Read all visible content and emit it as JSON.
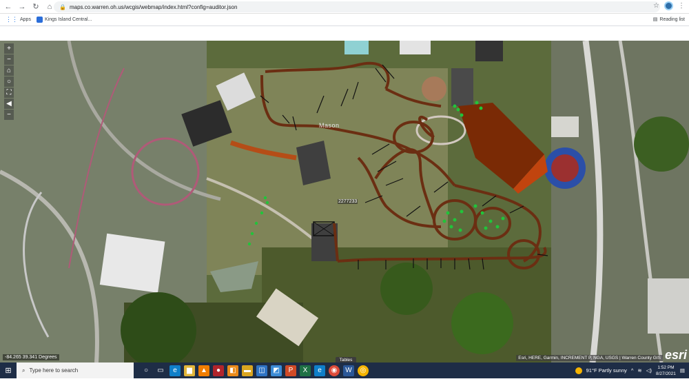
{
  "browser": {
    "url": "maps.co.warren.oh.us/wcgis/webmap/index.html?config=auditor.json",
    "bookmarks": [
      {
        "label": "Apps"
      },
      {
        "label": "Kings Island Central..."
      }
    ],
    "reading_list": "Reading list"
  },
  "map": {
    "place_label": "Mason",
    "parcel_label": "2277233",
    "tools": [
      {
        "icon": "zoom-in-icon",
        "glyph": "+"
      },
      {
        "icon": "zoom-out-icon",
        "glyph": "−"
      },
      {
        "icon": "home-icon",
        "glyph": "⌂"
      },
      {
        "icon": "locate-icon",
        "glyph": "○"
      },
      {
        "icon": "fullscreen-icon",
        "glyph": "⛶"
      },
      {
        "icon": "back-icon",
        "glyph": "◀"
      },
      {
        "icon": "minus-tool-icon",
        "glyph": "−"
      }
    ],
    "coordinate_readout": "-84.265 39.341 Degrees",
    "attribution": "Esri, HERE, Garmin, INCREMENT P, NGA, USGS | Warren County GIS",
    "logo": "esri",
    "tables_tab": "Tables",
    "colors": {
      "track": "#6b2e12",
      "building": "#7a2a05",
      "pad": "#3f3f3f",
      "green_points": "#21c43a"
    }
  },
  "taskbar": {
    "search_placeholder": "Type here to search",
    "weather": "91°F  Partly sunny",
    "time": "1:52 PM",
    "date": "8/27/2021"
  }
}
